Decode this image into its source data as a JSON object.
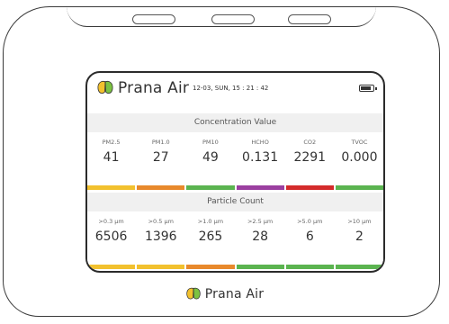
{
  "brand": {
    "name": "Prana Air"
  },
  "screen": {
    "datetime": "12-03, SUN, 15 : 21 : 42",
    "battery_level": 0.85,
    "concentration": {
      "title": "Concentration Value",
      "items": [
        {
          "label": "PM2.5",
          "value": "41",
          "color": "#f2c12e"
        },
        {
          "label": "PM1.0",
          "value": "27",
          "color": "#e8892c"
        },
        {
          "label": "PM10",
          "value": "49",
          "color": "#5bb450"
        },
        {
          "label": "HCHO",
          "value": "0.131",
          "color": "#9b3fa0"
        },
        {
          "label": "CO2",
          "value": "2291",
          "color": "#d42b2b"
        },
        {
          "label": "TVOC",
          "value": "0.000",
          "color": "#5bb450"
        }
      ]
    },
    "particles": {
      "title": "Particle Count",
      "items": [
        {
          "label": ">0.3 μm",
          "value": "6506",
          "color": "#f2c12e"
        },
        {
          "label": ">0.5 μm",
          "value": "1396",
          "color": "#f2c12e"
        },
        {
          "label": ">1.0 μm",
          "value": "265",
          "color": "#e8892c"
        },
        {
          "label": ">2.5 μm",
          "value": "28",
          "color": "#5bb450"
        },
        {
          "label": ">5.0 μm",
          "value": "6",
          "color": "#5bb450"
        },
        {
          "label": ">10 μm",
          "value": "2",
          "color": "#5bb450"
        }
      ]
    }
  }
}
